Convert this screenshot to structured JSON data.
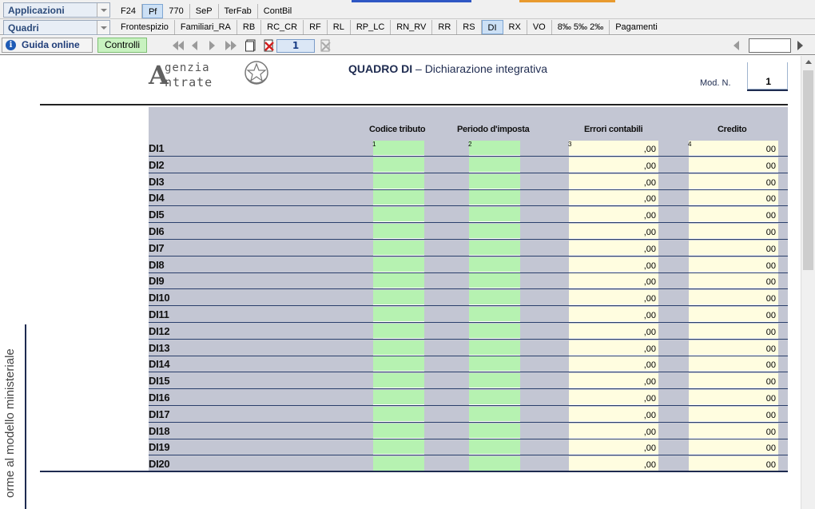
{
  "menu": {
    "applicazioni": "Applicazioni",
    "quadri": "Quadri",
    "tabs_row1": [
      "F24",
      "Pf",
      "770",
      "SeP",
      "TerFab",
      "ContBil"
    ],
    "tabs_row1_active": 1,
    "tabs_row2": [
      "Frontespizio",
      "Familiari_RA",
      "RB",
      "RC_CR",
      "RF",
      "RL",
      "RP_LC",
      "RN_RV",
      "RR",
      "RS",
      "DI",
      "RX",
      "VO",
      "8‰ 5‰ 2‰",
      "Pagamenti"
    ],
    "tabs_row2_active": 10
  },
  "toolbar": {
    "guida": "Guida online",
    "controlli": "Controlli",
    "page_value": "1",
    "search_value": ""
  },
  "header": {
    "logo_line1": "genzia",
    "logo_line2": "ntrate",
    "logo_letter": "A",
    "title_bold": "QUADRO DI",
    "title_rest": " – Dichiarazione integrativa",
    "mod_label": "Mod. N.",
    "mod_value": "1"
  },
  "side_text": "orme al modello ministeriale",
  "table": {
    "columns": [
      "Codice tributo",
      "Periodo d'imposta",
      "Errori contabili",
      "Credito"
    ],
    "column_numbers": [
      "1",
      "2",
      "3",
      "4"
    ],
    "rows": [
      {
        "label": "DI1",
        "errori": ",00",
        "credito": "00"
      },
      {
        "label": "DI2",
        "errori": ",00",
        "credito": "00"
      },
      {
        "label": "DI3",
        "errori": ",00",
        "credito": "00"
      },
      {
        "label": "DI4",
        "errori": ",00",
        "credito": "00"
      },
      {
        "label": "DI5",
        "errori": ",00",
        "credito": "00"
      },
      {
        "label": "DI6",
        "errori": ",00",
        "credito": "00"
      },
      {
        "label": "DI7",
        "errori": ",00",
        "credito": "00"
      },
      {
        "label": "DI8",
        "errori": ",00",
        "credito": "00"
      },
      {
        "label": "DI9",
        "errori": ",00",
        "credito": "00"
      },
      {
        "label": "DI10",
        "errori": ",00",
        "credito": "00"
      },
      {
        "label": "DI11",
        "errori": ",00",
        "credito": "00"
      },
      {
        "label": "DI12",
        "errori": ",00",
        "credito": "00"
      },
      {
        "label": "DI13",
        "errori": ",00",
        "credito": "00"
      },
      {
        "label": "DI14",
        "errori": ",00",
        "credito": "00"
      },
      {
        "label": "DI15",
        "errori": ",00",
        "credito": "00"
      },
      {
        "label": "DI16",
        "errori": ",00",
        "credito": "00"
      },
      {
        "label": "DI17",
        "errori": ",00",
        "credito": "00"
      },
      {
        "label": "DI18",
        "errori": ",00",
        "credito": "00"
      },
      {
        "label": "DI19",
        "errori": ",00",
        "credito": "00"
      },
      {
        "label": "DI20",
        "errori": ",00",
        "credito": "00"
      }
    ]
  },
  "colors": {
    "input_green": "#b6f2b1",
    "input_yellow": "#fffde0",
    "band_gray": "#c3c6d3",
    "navy": "#1e2b50"
  }
}
